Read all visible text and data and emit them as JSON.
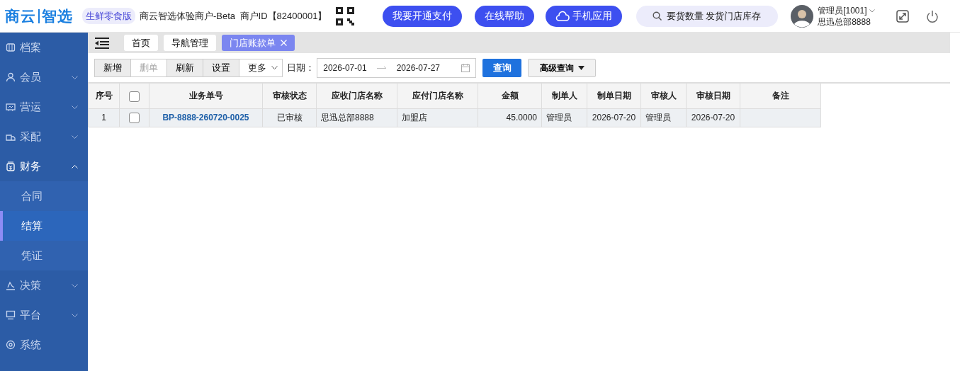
{
  "header": {
    "logo_left": "商云",
    "logo_right": "智选",
    "edition": "生鲜零食版",
    "merchant": "商户ID【82400001】",
    "merchant_name": "商云智选体验商户-Beta",
    "buttons": [
      {
        "label": "我要开通支付",
        "kind": "plain"
      },
      {
        "label": "在线帮助",
        "kind": "plain"
      },
      {
        "label": "手机应用",
        "kind": "cloud"
      }
    ],
    "search": {
      "value": "要货数量 发货门店库存"
    },
    "user": {
      "name": "管理员[1001]",
      "org": "思迅总部8888"
    }
  },
  "sidebar": {
    "items": [
      {
        "label": "档案",
        "kind": "leaf"
      },
      {
        "label": "会员",
        "kind": "group",
        "expanded": false
      },
      {
        "label": "营运",
        "kind": "group",
        "expanded": false
      },
      {
        "label": "采配",
        "kind": "group",
        "expanded": false
      },
      {
        "label": "财务",
        "kind": "group",
        "expanded": true,
        "children": [
          {
            "label": "合同",
            "selected": false
          },
          {
            "label": "结算",
            "selected": true
          },
          {
            "label": "凭证",
            "selected": false
          }
        ]
      },
      {
        "label": "决策",
        "kind": "group",
        "expanded": false
      },
      {
        "label": "平台",
        "kind": "group",
        "expanded": false
      },
      {
        "label": "系统",
        "kind": "leaf"
      }
    ]
  },
  "tabs": [
    {
      "label": "首页",
      "selected": false,
      "closable": false
    },
    {
      "label": "导航管理",
      "selected": false,
      "closable": false
    },
    {
      "label": "门店账款单",
      "selected": true,
      "closable": true
    }
  ],
  "toolbar": {
    "buttons": [
      {
        "label": "新增",
        "disabled": false
      },
      {
        "label": "删单",
        "disabled": true
      },
      {
        "label": "刷新",
        "disabled": false
      },
      {
        "label": "设置",
        "disabled": false
      }
    ],
    "more": "更多",
    "date_label": "日期：",
    "date_from": "2026-07-01",
    "date_to": "2026-07-27",
    "query": "查询",
    "advanced": "高级查询"
  },
  "table": {
    "columns": [
      {
        "label": "序号"
      },
      {
        "kind": "check"
      },
      {
        "label": "业务单号"
      },
      {
        "label": "审核状态"
      },
      {
        "label": "应收门店名称"
      },
      {
        "label": "应付门店名称"
      },
      {
        "label": "金额"
      },
      {
        "label": "制单人"
      },
      {
        "label": "制单日期"
      },
      {
        "label": "审核人"
      },
      {
        "label": "审核日期"
      },
      {
        "label": "备注"
      }
    ],
    "header_checked": false,
    "rows": [
      {
        "checked": false,
        "cells": [
          "1",
          null,
          "BP-8888-260720-0025",
          "已审核",
          "思迅总部8888",
          "加盟店",
          "45.0000",
          "管理员",
          "2026-07-20",
          "管理员",
          "2026-07-20",
          null
        ]
      }
    ]
  }
}
